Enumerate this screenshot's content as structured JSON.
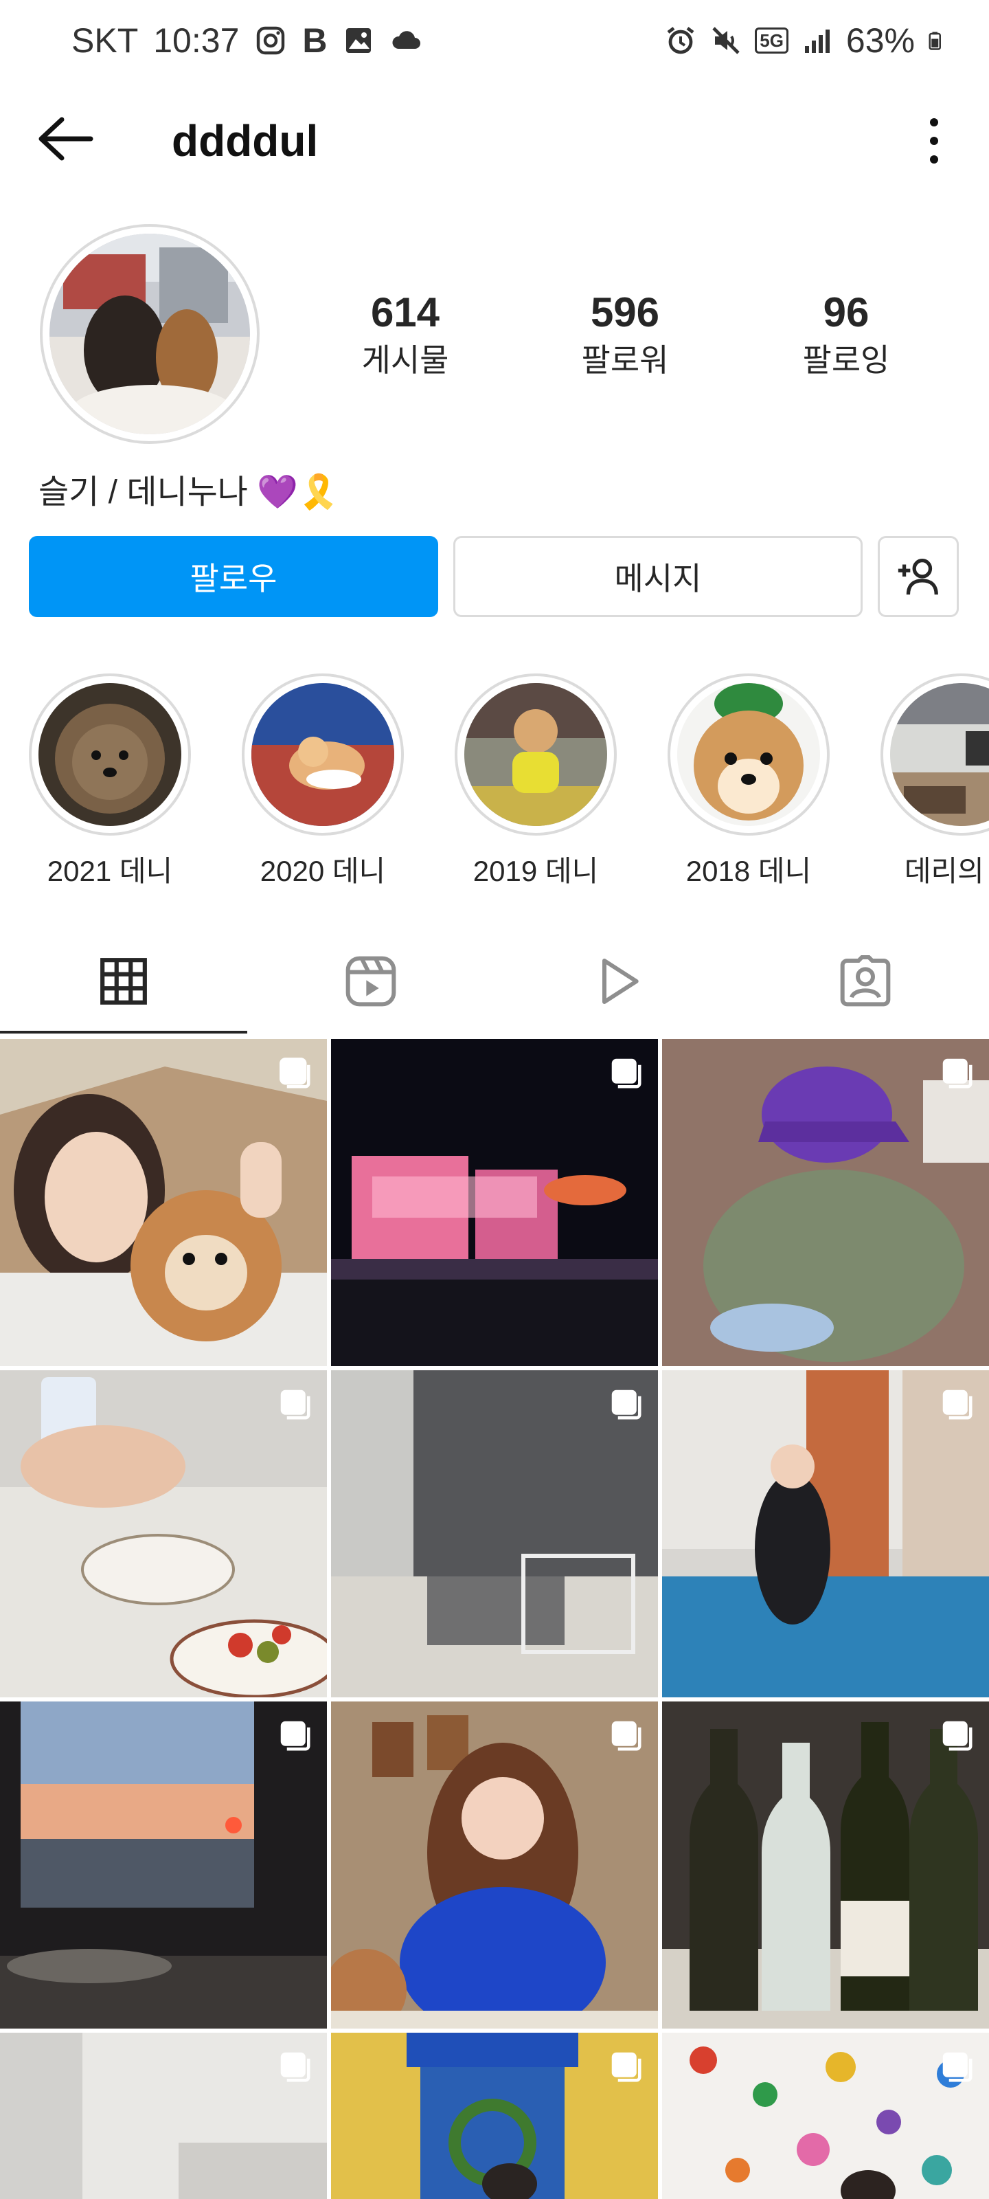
{
  "status_bar": {
    "carrier": "SKT",
    "time": "10:37",
    "app_letter": "B",
    "network": "5G",
    "battery": "63%"
  },
  "header": {
    "username": "ddddul"
  },
  "profile": {
    "stats": [
      {
        "value": "614",
        "label": "게시물"
      },
      {
        "value": "596",
        "label": "팔로워"
      },
      {
        "value": "96",
        "label": "팔로잉"
      }
    ],
    "bio": "슬기 / 데니누나 💜🎗️"
  },
  "buttons": {
    "follow": "팔로우",
    "message": "메시지",
    "suggest_icon": "add-person-icon"
  },
  "highlights": [
    {
      "label": "2021 데니"
    },
    {
      "label": "2020 데니"
    },
    {
      "label": "2019 데니"
    },
    {
      "label": "2018 데니"
    },
    {
      "label": "데리의 하"
    }
  ],
  "tabs": [
    {
      "icon": "grid-icon",
      "active": true
    },
    {
      "icon": "reels-icon",
      "active": false
    },
    {
      "icon": "play-icon",
      "active": false
    },
    {
      "icon": "tagged-icon",
      "active": false
    }
  ],
  "colors": {
    "accent": "#0095f6",
    "border": "#dbdbdb",
    "text": "#262626"
  }
}
